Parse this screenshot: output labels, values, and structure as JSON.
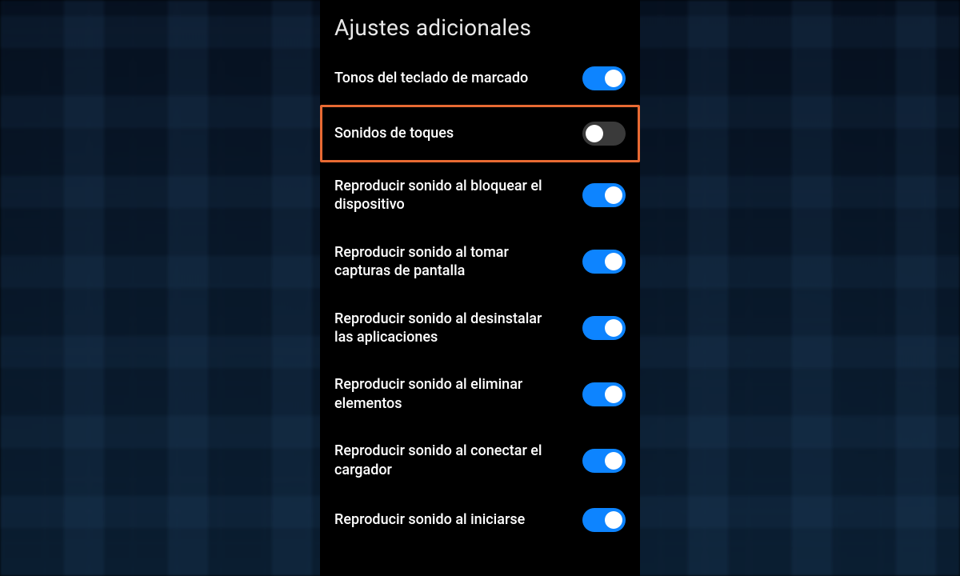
{
  "page": {
    "title": "Ajustes adicionales"
  },
  "settings": [
    {
      "label": "Tonos del teclado de marcado",
      "enabled": true,
      "highlighted": false
    },
    {
      "label": "Sonidos de toques",
      "enabled": false,
      "highlighted": true
    },
    {
      "label": "Reproducir sonido al bloquear el dispositivo",
      "enabled": true,
      "highlighted": false
    },
    {
      "label": "Reproducir sonido al tomar capturas de pantalla",
      "enabled": true,
      "highlighted": false
    },
    {
      "label": "Reproducir sonido al desinstalar las aplicaciones",
      "enabled": true,
      "highlighted": false
    },
    {
      "label": "Reproducir sonido al eliminar elementos",
      "enabled": true,
      "highlighted": false
    },
    {
      "label": "Reproducir sonido al conectar el cargador",
      "enabled": true,
      "highlighted": false
    },
    {
      "label": "Reproducir sonido al iniciarse",
      "enabled": true,
      "highlighted": false
    }
  ],
  "colors": {
    "accent_on": "#0d84ff",
    "accent_off": "#3a3a3a",
    "highlight_border": "#e86a33"
  }
}
